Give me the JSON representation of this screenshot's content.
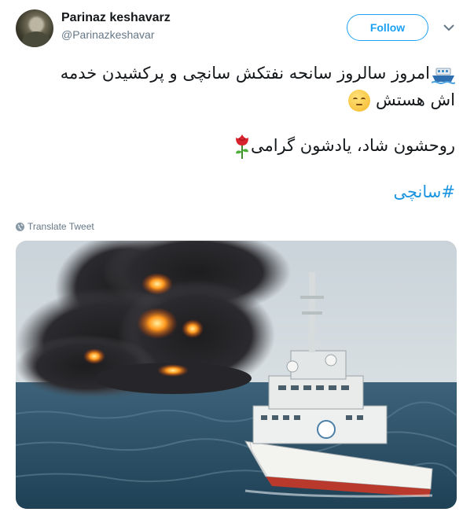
{
  "user": {
    "display_name": "Parinaz keshavarz",
    "handle": "@Parinazkeshavar"
  },
  "follow_button": {
    "label": "Follow"
  },
  "tweet": {
    "line1": "امروز سالروز سانحه نفتکش سانچی و پرکشیدن خدمه",
    "line2": "اش هستش",
    "line3": "روحشون شاد، یادشون گرامی",
    "hashtag": "#سانچی",
    "emojis": [
      "ship-emoji",
      "pensive-face-emoji",
      "rose-emoji"
    ]
  },
  "translate": {
    "label": "Translate Tweet"
  },
  "media": {
    "icon": "photo-burning-tanker"
  },
  "colors": {
    "accent": "#1da1f2",
    "link": "#1b95e0",
    "muted": "#657786"
  }
}
